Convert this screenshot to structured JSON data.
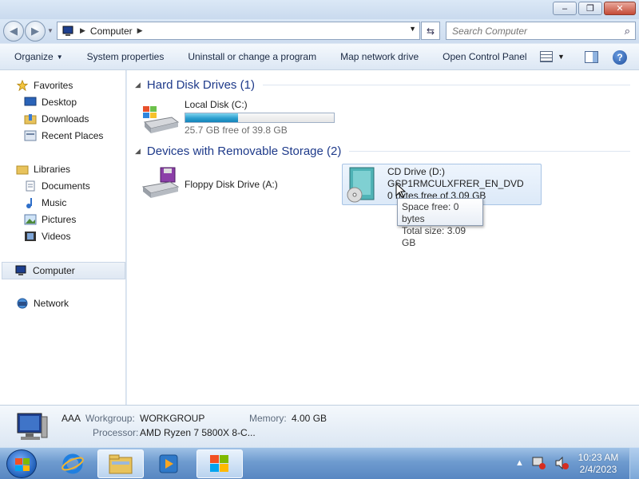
{
  "window": {
    "minimize_glyph": "–",
    "maximize_glyph": "❐",
    "close_glyph": "✕"
  },
  "address": {
    "breadcrumb": [
      "Computer"
    ],
    "search_placeholder": "Search Computer"
  },
  "toolbar": {
    "organize": "Organize",
    "system_properties": "System properties",
    "uninstall": "Uninstall or change a program",
    "map_drive": "Map network drive",
    "control_panel": "Open Control Panel"
  },
  "sidebar": {
    "favorites": "Favorites",
    "desktop": "Desktop",
    "downloads": "Downloads",
    "recent": "Recent Places",
    "libraries": "Libraries",
    "documents": "Documents",
    "music": "Music",
    "pictures": "Pictures",
    "videos": "Videos",
    "computer": "Computer",
    "network": "Network"
  },
  "groups": {
    "hdd": "Hard Disk Drives (1)",
    "removable": "Devices with Removable Storage (2)"
  },
  "drives": {
    "c": {
      "name": "Local Disk (C:)",
      "free_text": "25.7 GB free of 39.8 GB",
      "used_fraction": 0.354
    },
    "a": {
      "name": "Floppy Disk Drive (A:)"
    },
    "d": {
      "name": "CD Drive (D:)",
      "label": "GSP1RMCULXFRER_EN_DVD",
      "free_text": "0 bytes free of 3.09 GB"
    }
  },
  "tooltip": {
    "line1": "Space free: 0 bytes",
    "line2": "Total size: 3.09 GB"
  },
  "details": {
    "name": "AAA",
    "workgroup_label": "Workgroup:",
    "workgroup": "WORKGROUP",
    "memory_label": "Memory:",
    "memory": "4.00 GB",
    "processor_label": "Processor:",
    "processor": "AMD Ryzen 7 5800X 8-C..."
  },
  "taskbar": {
    "time": "10:23 AM",
    "date": "2/4/2023",
    "tray_arrow": "▲"
  },
  "colors": {
    "accent": "#1e3a8a",
    "progress": "#2c9fcf"
  }
}
